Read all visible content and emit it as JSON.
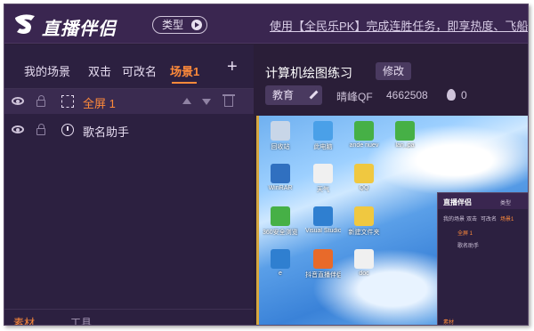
{
  "app": {
    "title": "直播伴侣",
    "type_button": "类型",
    "marquee": "使用【全民乐PK】完成连胜任务，即享热度、飞船"
  },
  "scene_tabs": [
    {
      "label": "我的场景"
    },
    {
      "label": "双击"
    },
    {
      "label": "可改名"
    },
    {
      "label": "场景1",
      "active": true
    }
  ],
  "add_scene": "+",
  "sources": [
    {
      "label": "全屏 1",
      "selected": true,
      "color": "#ff8a3a"
    },
    {
      "label": "歌名助手",
      "selected": false,
      "color": "#e6dcf0"
    }
  ],
  "bottom_tabs": [
    "素材",
    "工具"
  ],
  "room": {
    "title": "计算机绘图练习",
    "edit_button": "修改",
    "category": "教育",
    "user": "晴峰QF",
    "room_id": "4662508",
    "heat": "0"
  },
  "desktop_icons": [
    {
      "label": "回收站",
      "color": "#c8d6e8"
    },
    {
      "label": "此电脑",
      "color": "#4aa0e8"
    },
    {
      "label": "ande nuev",
      "color": "#46b046"
    },
    {
      "label": "lan_pa",
      "color": "#46b046"
    },
    {
      "label": "WinRAR",
      "color": "#3070c0"
    },
    {
      "label": "天气",
      "color": "#f0f0f0"
    },
    {
      "label": "QQ",
      "color": "#f0c840"
    },
    {
      "label": "360安全浏览器",
      "color": "#46b046"
    },
    {
      "label": "Visual Studio",
      "color": "#2f7fd0"
    },
    {
      "label": "新建文件夹",
      "color": "#f0c840"
    },
    {
      "label": "e",
      "color": "#2f7fd0"
    },
    {
      "label": "抖音直播伴侣",
      "color": "#e86a2a"
    },
    {
      "label": "doc",
      "color": "#f0f0f0"
    }
  ],
  "mini_app": {
    "title": "直播伴侣",
    "type_button": "类型",
    "tabs": [
      "我的场景",
      "双击",
      "可改名",
      "场景1"
    ],
    "sources": [
      "全屏 1",
      "歌名助手"
    ],
    "bottom": "素材"
  },
  "colors": {
    "bg": "#2a1e38",
    "accent": "#ff8a3a",
    "topbar": "#3a2650"
  }
}
